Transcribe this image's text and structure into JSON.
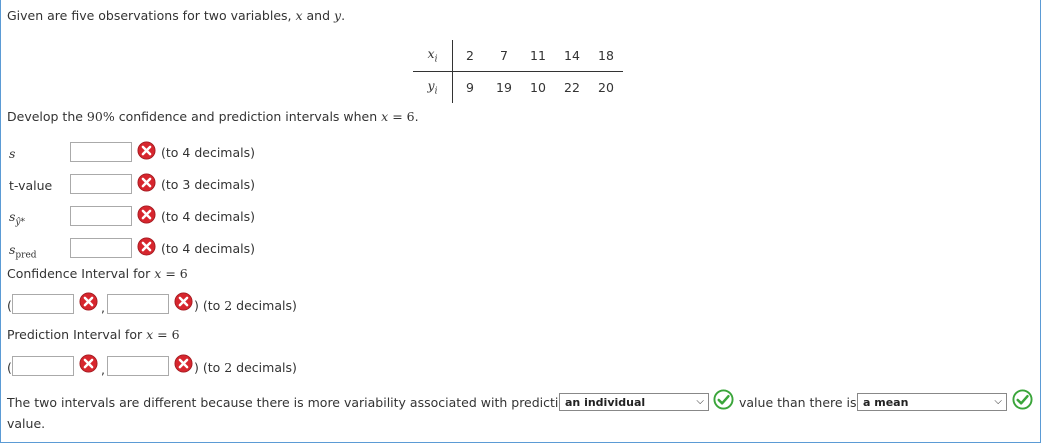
{
  "intro": "Given are five observations for two variables, x and y.",
  "table": {
    "x_label": "x",
    "x_sub": "i",
    "y_label": "y",
    "y_sub": "i",
    "x_values": [
      "2",
      "7",
      "11",
      "14",
      "18"
    ],
    "y_values": [
      "9",
      "19",
      "10",
      "22",
      "20"
    ]
  },
  "instruction": "Develop the 90% confidence and prediction intervals when x = 6.",
  "fields": [
    {
      "label": "s",
      "hint": "(to 4 decimals)"
    },
    {
      "label": "t-value",
      "hint": "(to 3 decimals)"
    },
    {
      "label": "s_ŷ*",
      "hint": "(to 4 decimals)"
    },
    {
      "label": "s_pred",
      "hint": "(to 4 decimals)"
    }
  ],
  "confidence": {
    "label": "Confidence Interval for x = 6",
    "hint": ") (to 2 decimals)",
    "open": "(",
    "comma": ","
  },
  "prediction": {
    "label": "Prediction Interval for x = 6",
    "hint": ") (to 2 decimals)",
    "open": "(",
    "comma": ","
  },
  "sentence": {
    "part1": "The two intervals are different because there is more variability associated with predicting",
    "select1": "an individual",
    "part2": "value than there is",
    "select2": "a mean",
    "part3": "value."
  },
  "colors": {
    "wrong": "#d7262e",
    "correct": "#3aa53a",
    "frame": "#5b9bd5"
  }
}
